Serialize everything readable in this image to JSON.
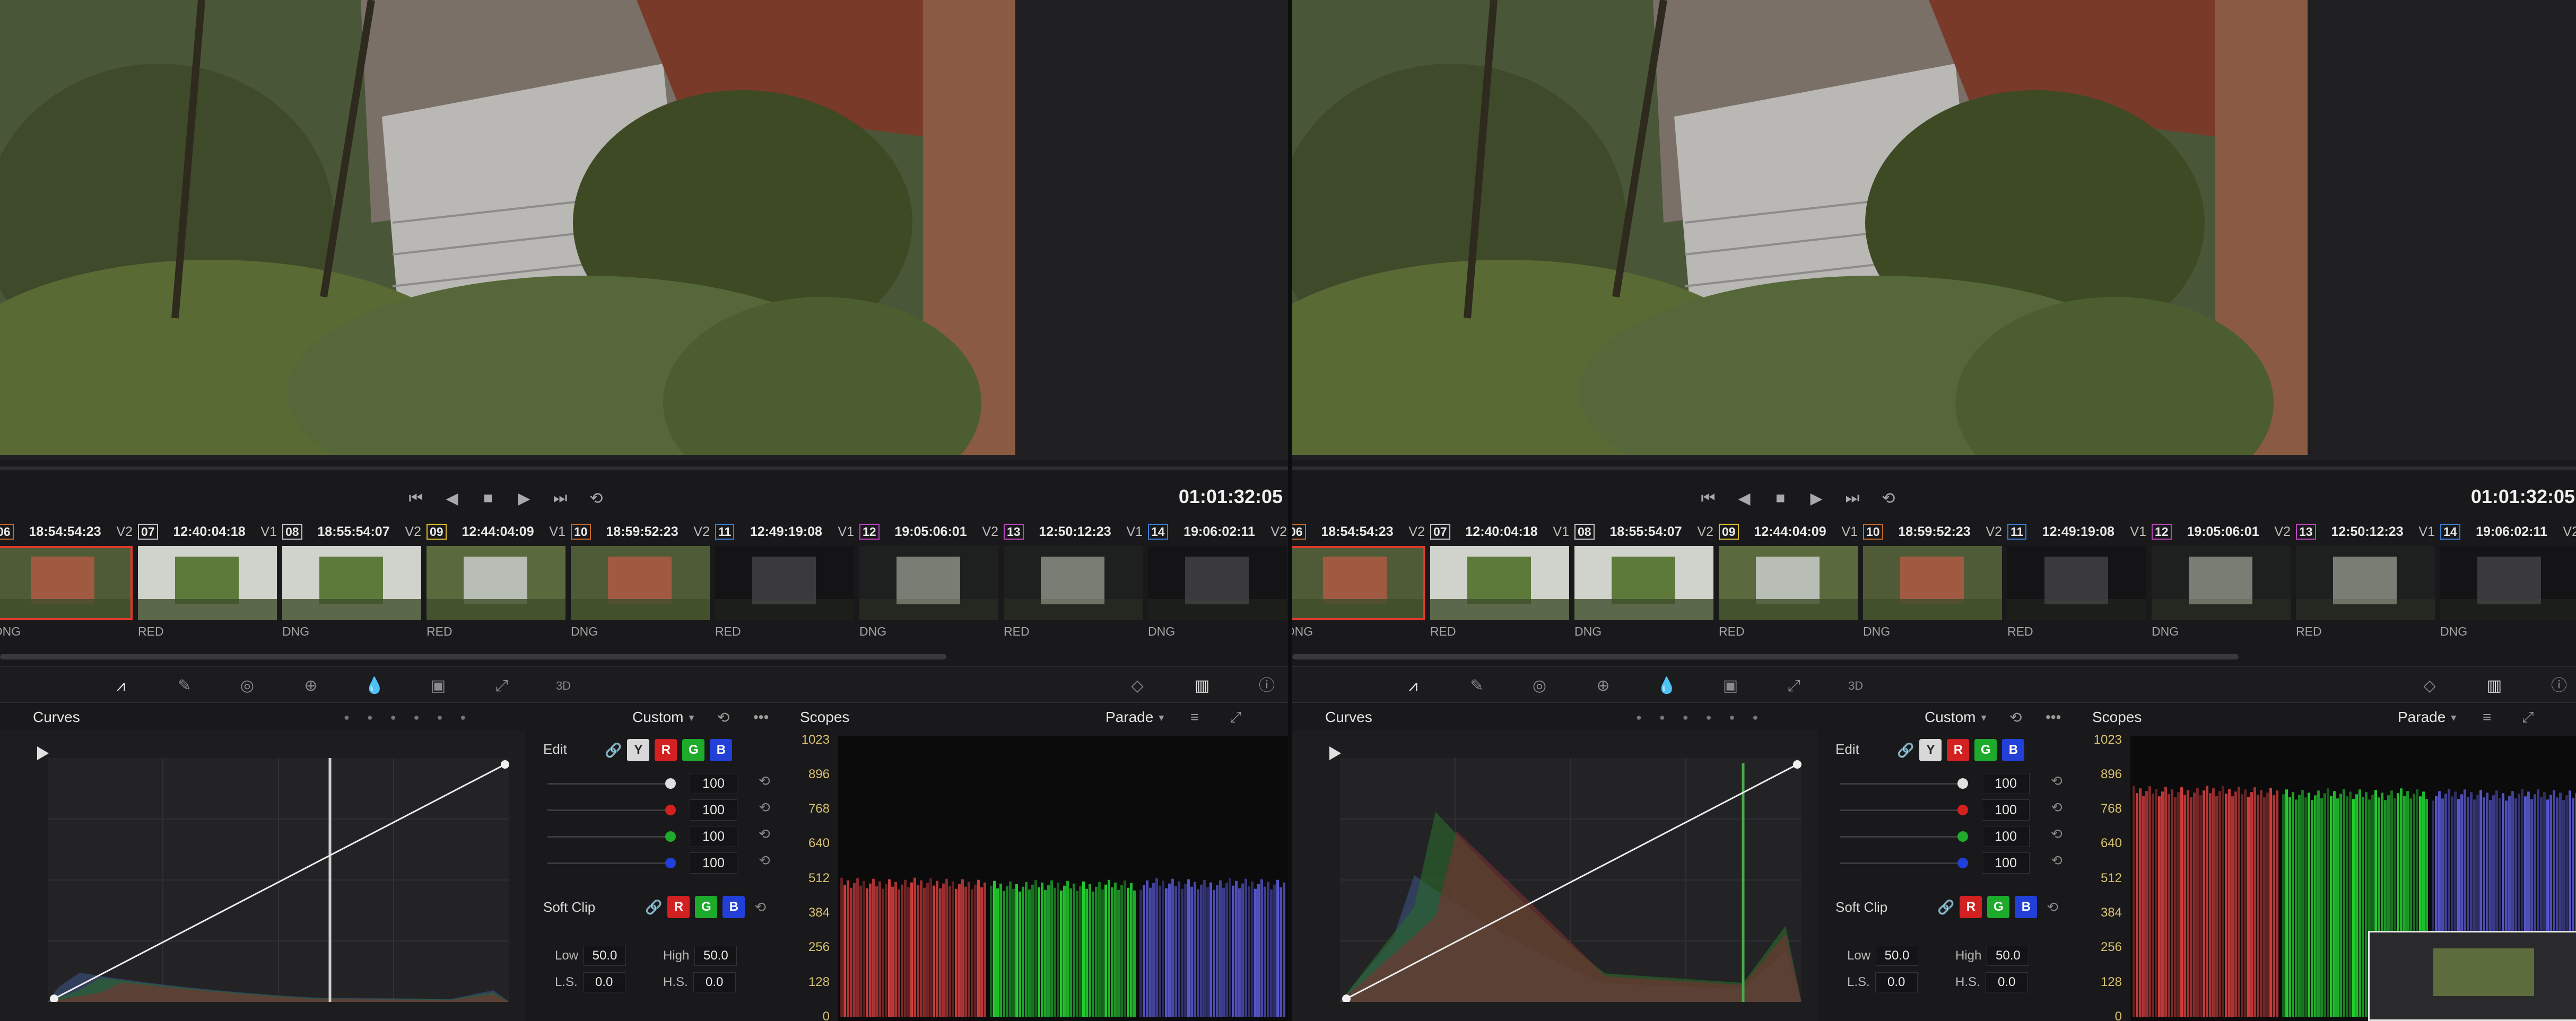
{
  "timecode": "01:01:32:05",
  "clips": [
    {
      "num": "06",
      "tc": "18:54:54:23",
      "track": "V2",
      "fmt": "DNG",
      "tone": "a"
    },
    {
      "num": "07",
      "tc": "12:40:04:18",
      "track": "V1",
      "fmt": "RED",
      "tone": "b"
    },
    {
      "num": "08",
      "tc": "18:55:54:07",
      "track": "V2",
      "fmt": "DNG",
      "tone": "b"
    },
    {
      "num": "09",
      "tc": "12:44:04:09",
      "track": "V1",
      "fmt": "RED",
      "tone": "e"
    },
    {
      "num": "10",
      "tc": "18:59:52:23",
      "track": "V2",
      "fmt": "DNG",
      "tone": "a"
    },
    {
      "num": "11",
      "tc": "12:49:19:08",
      "track": "V1",
      "fmt": "RED",
      "tone": "c"
    },
    {
      "num": "12",
      "tc": "19:05:06:01",
      "track": "V2",
      "fmt": "DNG",
      "tone": "d"
    },
    {
      "num": "13",
      "tc": "12:50:12:23",
      "track": "V1",
      "fmt": "RED",
      "tone": "d"
    },
    {
      "num": "14",
      "tc": "19:06:02:11",
      "track": "V2",
      "fmt": "DNG",
      "tone": "c"
    }
  ],
  "curves": {
    "title": "Curves",
    "preset": "Custom",
    "edit_label": "Edit",
    "channels": [
      "Y",
      "R",
      "G",
      "B"
    ],
    "intensity": [
      "100",
      "100",
      "100",
      "100"
    ],
    "soft_clip_label": "Soft Clip",
    "low_label": "Low",
    "low": "50.0",
    "high_label": "High",
    "high": "50.0",
    "ls_label": "L.S.",
    "ls": "0.0",
    "hs_label": "H.S.",
    "hs": "0.0"
  },
  "scopes": {
    "title": "Scopes",
    "mode": "Parade",
    "scale": [
      "1023",
      "896",
      "768",
      "640",
      "512",
      "384",
      "256",
      "128",
      "0"
    ]
  },
  "colors": {
    "accent_red": "#e03a2a",
    "scope_red": "#ff4a4a",
    "scope_green": "#2aff3a",
    "scope_blue": "#6a6aff"
  }
}
